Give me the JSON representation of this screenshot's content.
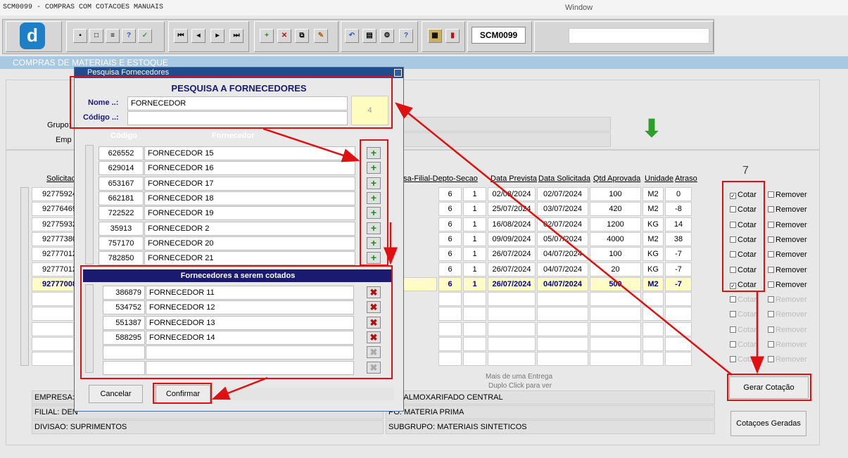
{
  "window": {
    "title": "SCM0099 - COMPRAS COM COTACOES MANUAIS",
    "menu": "Window",
    "form_code": "SCM0099"
  },
  "section": {
    "title": "COMPRAS DE MATERIAIS E ESTOQUE"
  },
  "main": {
    "grupo_label": "Grupo:",
    "emp_label": "Emp",
    "count_label": "7",
    "columns": [
      "Solicitac",
      "esa-Filial-Depto-Secao",
      "Data Prevista",
      "Data Solicitada",
      "Qtd Aprovada",
      "Unidade",
      "Atraso"
    ],
    "rows": [
      {
        "sol": "92775924",
        "a": "6",
        "b": "1",
        "prev": "02/08/2024",
        "solic": "02/07/2024",
        "qtd": "100",
        "un": "M2",
        "atraso": "0",
        "cotar": true
      },
      {
        "sol": "92776469",
        "a": "6",
        "b": "1",
        "prev": "25/07/2024",
        "solic": "03/07/2024",
        "qtd": "420",
        "un": "M2",
        "atraso": "-8",
        "cotar": false
      },
      {
        "sol": "92775932",
        "a": "6",
        "b": "1",
        "prev": "16/08/2024",
        "solic": "02/07/2024",
        "qtd": "1200",
        "un": "KG",
        "atraso": "14",
        "cotar": false
      },
      {
        "sol": "92777380",
        "a": "6",
        "b": "1",
        "prev": "09/09/2024",
        "solic": "05/07/2024",
        "qtd": "4000",
        "un": "M2",
        "atraso": "38",
        "cotar": false
      },
      {
        "sol": "92777012",
        "a": "6",
        "b": "1",
        "prev": "26/07/2024",
        "solic": "04/07/2024",
        "qtd": "100",
        "un": "KG",
        "atraso": "-7",
        "cotar": false
      },
      {
        "sol": "92777012",
        "a": "6",
        "b": "1",
        "prev": "26/07/2024",
        "solic": "04/07/2024",
        "qtd": "20",
        "un": "KG",
        "atraso": "-7",
        "cotar": false
      },
      {
        "sol": "92777008",
        "a": "6",
        "b": "1",
        "prev": "26/07/2024",
        "solic": "04/07/2024",
        "qtd": "500",
        "un": "M2",
        "atraso": "-7",
        "cotar": true
      }
    ],
    "cotar_label": "Cotar",
    "remover_label": "Remover",
    "hint1": "Mais de uma Entrega",
    "hint2": "Duplo Click para ver",
    "gerar_btn": "Gerar Cotação",
    "geradas_btn": "Cotaçoes Geradas",
    "info": {
      "empresa": "EMPRESA:",
      "filial": "FILIAL: DEN",
      "divisao": "DIVISAO: SUPRIMENTOS",
      "secao": "AO: ALMOXARIFADO CENTRAL",
      "grupo": "PO: MATERIA PRIMA",
      "subgrupo": "SUBGRUPO: MATERIAIS SINTETICOS"
    }
  },
  "dialog": {
    "title": "Pesquisa Fornecedores",
    "heading": "PESQUISA A FORNECEDORES",
    "nome_label": "Nome ..:",
    "nome_value": "FORNECEDOR",
    "codigo_label": "Código ..:",
    "codigo_value": "",
    "count": "4",
    "col_codigo": "Código",
    "col_fornecedor": "Fornecedor",
    "results": [
      {
        "codigo": "626552",
        "nome": "FORNECEDOR 15"
      },
      {
        "codigo": "629014",
        "nome": "FORNECEDOR 16"
      },
      {
        "codigo": "653167",
        "nome": "FORNECEDOR 17"
      },
      {
        "codigo": "662181",
        "nome": "FORNECEDOR 18"
      },
      {
        "codigo": "722522",
        "nome": "FORNECEDOR 19"
      },
      {
        "codigo": "35913",
        "nome": "FORNECEDOR 2"
      },
      {
        "codigo": "757170",
        "nome": "FORNECEDOR 20"
      },
      {
        "codigo": "782850",
        "nome": "FORNECEDOR 21"
      }
    ],
    "selected_heading": "Fornecedores a serem cotados",
    "selected": [
      {
        "codigo": "386879",
        "nome": "FORNECEDOR 11"
      },
      {
        "codigo": "534752",
        "nome": "FORNECEDOR 12"
      },
      {
        "codigo": "551387",
        "nome": "FORNECEDOR 13"
      },
      {
        "codigo": "588295",
        "nome": "FORNECEDOR 14"
      }
    ],
    "cancel_btn": "Cancelar",
    "confirm_btn": "Confirmar"
  }
}
